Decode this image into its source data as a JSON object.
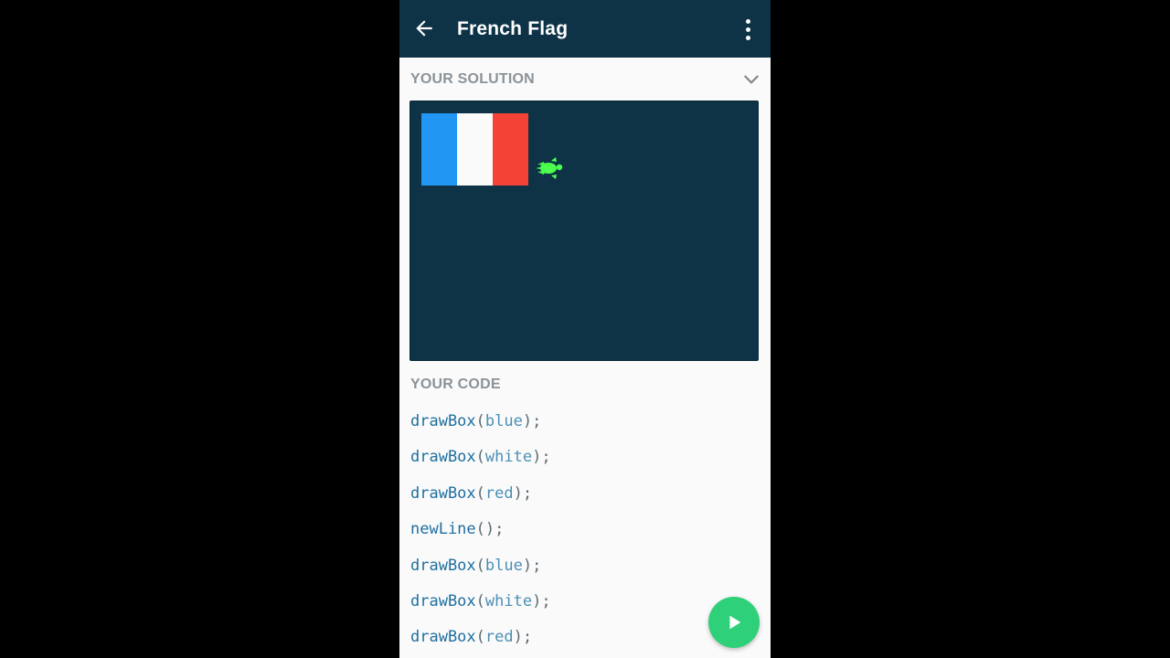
{
  "appbar": {
    "title": "French Flag",
    "back_icon": "arrow-left-icon",
    "menu_icon": "more-vertical-icon",
    "background": "#0e3347"
  },
  "solution": {
    "label": "YOUR SOLUTION",
    "collapse_icon": "chevron-down-icon",
    "canvas_background": "#0e3347",
    "boxes": [
      {
        "color_name": "blue",
        "color": "#2196f3"
      },
      {
        "color_name": "white",
        "color": "#fafafa"
      },
      {
        "color_name": "red",
        "color": "#f44336"
      }
    ],
    "turtle_icon": "turtle-icon",
    "turtle_color": "#4cff4c"
  },
  "code": {
    "label": "YOUR CODE",
    "lines": [
      {
        "fn": "drawBox",
        "arg": "blue"
      },
      {
        "fn": "drawBox",
        "arg": "white"
      },
      {
        "fn": "drawBox",
        "arg": "red"
      },
      {
        "fn": "newLine",
        "arg": ""
      },
      {
        "fn": "drawBox",
        "arg": "blue"
      },
      {
        "fn": "drawBox",
        "arg": "white"
      },
      {
        "fn": "drawBox",
        "arg": "red"
      }
    ]
  },
  "run_button": {
    "icon": "play-icon",
    "color": "#2fd07a"
  }
}
